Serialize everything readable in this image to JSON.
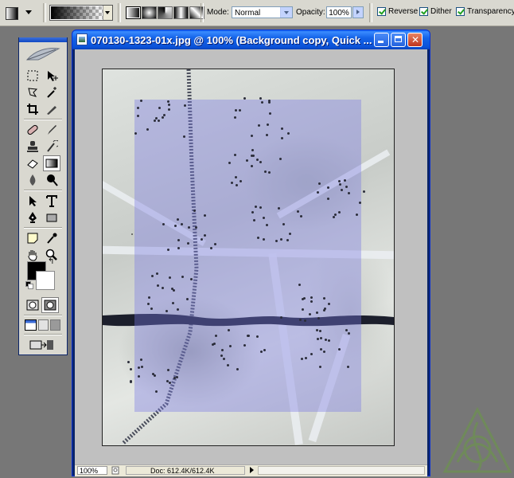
{
  "options_bar": {
    "mode_label": "Mode:",
    "mode_value": "Normal",
    "opacity_label": "Opacity:",
    "opacity_value": "100%",
    "reverse_label": "Reverse",
    "dither_label": "Dither",
    "transparency_label": "Transparency",
    "reverse_checked": true,
    "dither_checked": true,
    "transparency_checked": true
  },
  "document": {
    "title": "070130-1323-01x.jpg @ 100% (Background copy, Quick ...",
    "zoom": "100%",
    "doc_size": "Doc: 612.4K/612.4K"
  },
  "tools": [
    "marquee",
    "move",
    "lasso",
    "magic-wand",
    "crop",
    "slice",
    "healing-brush",
    "brush",
    "clone-stamp",
    "history-brush",
    "eraser",
    "gradient",
    "blur",
    "dodge",
    "path-selection",
    "type",
    "pen",
    "shape",
    "notes",
    "eyedropper",
    "hand",
    "zoom"
  ],
  "colors": {
    "foreground": "#000000",
    "background": "#ffffff",
    "quick_mask": "#7878e6",
    "titlebar": "#0b52d8"
  }
}
